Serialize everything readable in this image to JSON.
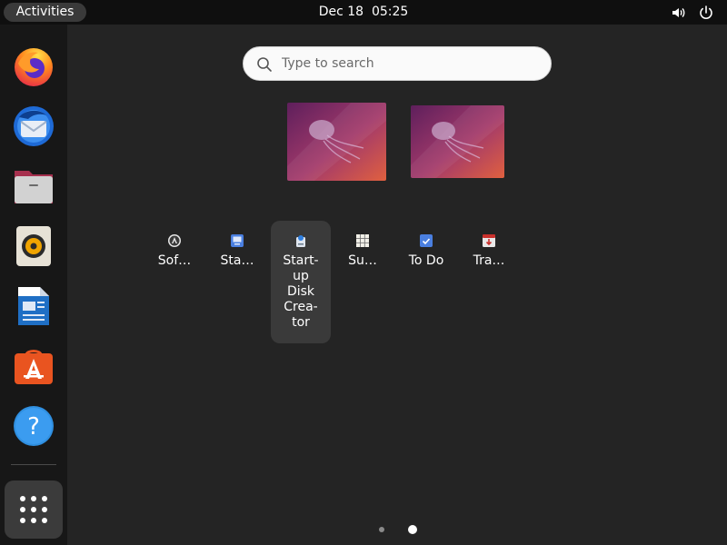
{
  "topbar": {
    "activities_label": "Activities",
    "date": "Dec 18",
    "time": "05:25",
    "icons": [
      "volume-icon",
      "power-icon"
    ]
  },
  "dock": {
    "items": [
      {
        "name": "Firefox",
        "icon": "firefox-icon"
      },
      {
        "name": "Thunderbird",
        "icon": "thunderbird-icon"
      },
      {
        "name": "Files",
        "icon": "files-icon"
      },
      {
        "name": "Rhythmbox",
        "icon": "rhythmbox-icon"
      },
      {
        "name": "LibreOffice Writer",
        "icon": "writer-icon"
      },
      {
        "name": "Ubuntu Software",
        "icon": "software-store-icon"
      },
      {
        "name": "Help",
        "icon": "help-icon"
      }
    ],
    "show_apps_icon": "app-grid-icon"
  },
  "search": {
    "placeholder": "Type to search"
  },
  "apps": [
    {
      "label": "Sof…",
      "icon": "software-updater-icon"
    },
    {
      "label": "Sta…",
      "icon": "startup-apps-icon"
    },
    {
      "label": "Start-up Disk Crea-tor",
      "label_lines": [
        "Start-",
        "up",
        "Disk",
        "Crea-",
        "tor"
      ],
      "icon": "startup-disk-creator-icon",
      "selected": true
    },
    {
      "label": "Su…",
      "icon": "sudoku-icon"
    },
    {
      "label": "To Do",
      "icon": "todo-icon"
    },
    {
      "label": "Tra…",
      "icon": "transmission-icon"
    }
  ],
  "pagination": {
    "pages": 2,
    "current": 2
  },
  "colors": {
    "accent": "#E95420",
    "topbar": "#0F0F0F",
    "dock": "#171717",
    "background": "#242424"
  }
}
